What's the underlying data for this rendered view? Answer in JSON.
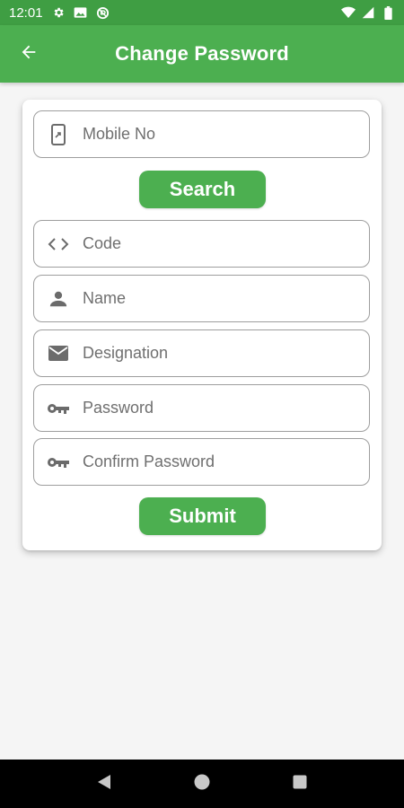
{
  "status_bar": {
    "time": "12:01",
    "icons_left": [
      "gear-icon",
      "image-icon",
      "do-not-disturb-icon"
    ],
    "icons_right": [
      "wifi-icon",
      "cell-signal-icon",
      "battery-icon"
    ]
  },
  "app_bar": {
    "title": "Change Password",
    "back_icon": "arrow-left-icon",
    "color": "#4caf50"
  },
  "form": {
    "mobile": {
      "placeholder": "Mobile No",
      "value": "",
      "icon": "phone-icon"
    },
    "search_button": "Search",
    "code": {
      "placeholder": "Code",
      "value": "",
      "icon": "code-brackets-icon"
    },
    "name": {
      "placeholder": "Name",
      "value": "",
      "icon": "person-icon"
    },
    "designation": {
      "placeholder": "Designation",
      "value": "",
      "icon": "mail-icon"
    },
    "password": {
      "placeholder": "Password",
      "value": "",
      "icon": "key-icon"
    },
    "confirm_password": {
      "placeholder": "Confirm Password",
      "value": "",
      "icon": "key-icon"
    },
    "submit_button": "Submit"
  },
  "nav_bar": {
    "icons": [
      "back-triangle-icon",
      "home-circle-icon",
      "recents-square-icon"
    ]
  }
}
